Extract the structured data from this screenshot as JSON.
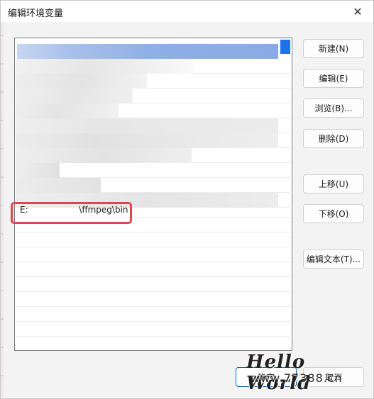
{
  "window": {
    "title": "编辑环境变量",
    "close_label": "✕"
  },
  "list": {
    "visible_entry": {
      "prefix": "E:",
      "suffix": "\\ffmpeg\\bin"
    }
  },
  "buttons": {
    "new": "新建(N)",
    "edit": "编辑(E)",
    "browse": "浏览(B)...",
    "delete": "删除(D)",
    "move_up": "上移(U)",
    "move_down": "下移(O)",
    "edit_text": "编辑文本(T)...",
    "ok": "确定",
    "cancel": "取消"
  },
  "watermark": {
    "line1": "Hello World",
    "line2": "www.77388.cn"
  },
  "colors": {
    "selection": "#8fb0e6",
    "highlight": "#e0454a",
    "accent": "#005fb8"
  }
}
